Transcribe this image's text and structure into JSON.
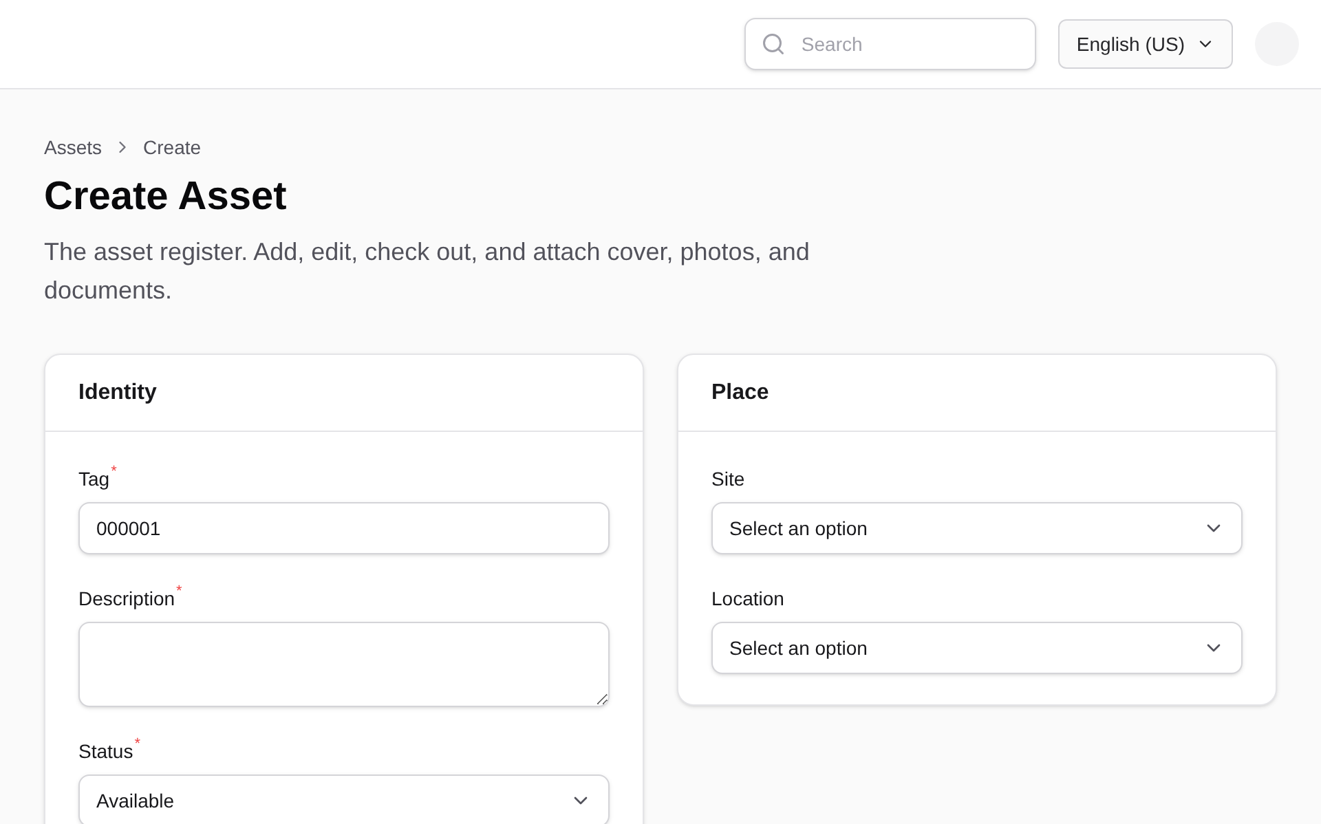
{
  "header": {
    "search": {
      "placeholder": "Search"
    },
    "language": "English (US)"
  },
  "breadcrumb": [
    "Assets",
    "Create"
  ],
  "title": "Create Asset",
  "description": "The asset register. Add, edit, check out, and attach cover, photos, and documents.",
  "cards": [
    {
      "title": "Identity",
      "fields": [
        {
          "kind": "text",
          "label": "Tag",
          "marker": "*",
          "value": "000001"
        },
        {
          "kind": "textarea",
          "label": "Description",
          "marker": "*"
        },
        {
          "kind": "select",
          "label": "Status",
          "marker": "*",
          "value": "Available"
        }
      ]
    },
    {
      "title": "Place",
      "fields": [
        {
          "kind": "select",
          "label": "Site",
          "value": "Select an option"
        },
        {
          "kind": "select",
          "label": "Location",
          "value": "Select an option"
        }
      ]
    }
  ]
}
